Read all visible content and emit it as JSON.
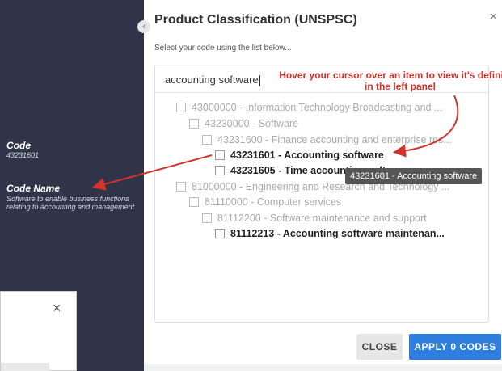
{
  "modal": {
    "title": "Product Classification (UNSPSC)",
    "close_icon": "×",
    "subtitle": "Select your code using the list below...",
    "collapse_icon": "‹"
  },
  "left_panel": {
    "code_label": "Code",
    "code_value": "43231601",
    "name_label": "Code Name",
    "name_value": "Software to enable business functions relating to accounting and management"
  },
  "search": {
    "value": "accounting software"
  },
  "tree": [
    {
      "label": "43000000 - Information Technology Broadcasting and ...",
      "state": "muted"
    },
    {
      "label": "43230000 - Software",
      "state": "muted"
    },
    {
      "label": "43231600 - Finance accounting and enterprise res...",
      "state": "muted"
    },
    {
      "label": "43231601 - Accounting software",
      "state": "strong"
    },
    {
      "label": "43231605 - Time accounting software",
      "state": "strong"
    },
    {
      "label": "81000000 - Engineering and Research and Technology ...",
      "state": "muted"
    },
    {
      "label": "81110000 - Computer services",
      "state": "muted"
    },
    {
      "label": "81112200 - Software maintenance and support",
      "state": "muted"
    },
    {
      "label": "81112213 - Accounting software maintenan...",
      "state": "strong"
    }
  ],
  "tooltip": "43231601 - Accounting software",
  "annotation": "Hover your cursor over an item to view it's definition in the left panel",
  "buttons": {
    "close": "CLOSE",
    "apply": "APPLY 0 CODES"
  },
  "background_dialog": {
    "close_icon": "×"
  },
  "colors": {
    "left_panel": "#2f3448",
    "apply_button": "#2f7fe0",
    "annotation": "#d0342c"
  }
}
